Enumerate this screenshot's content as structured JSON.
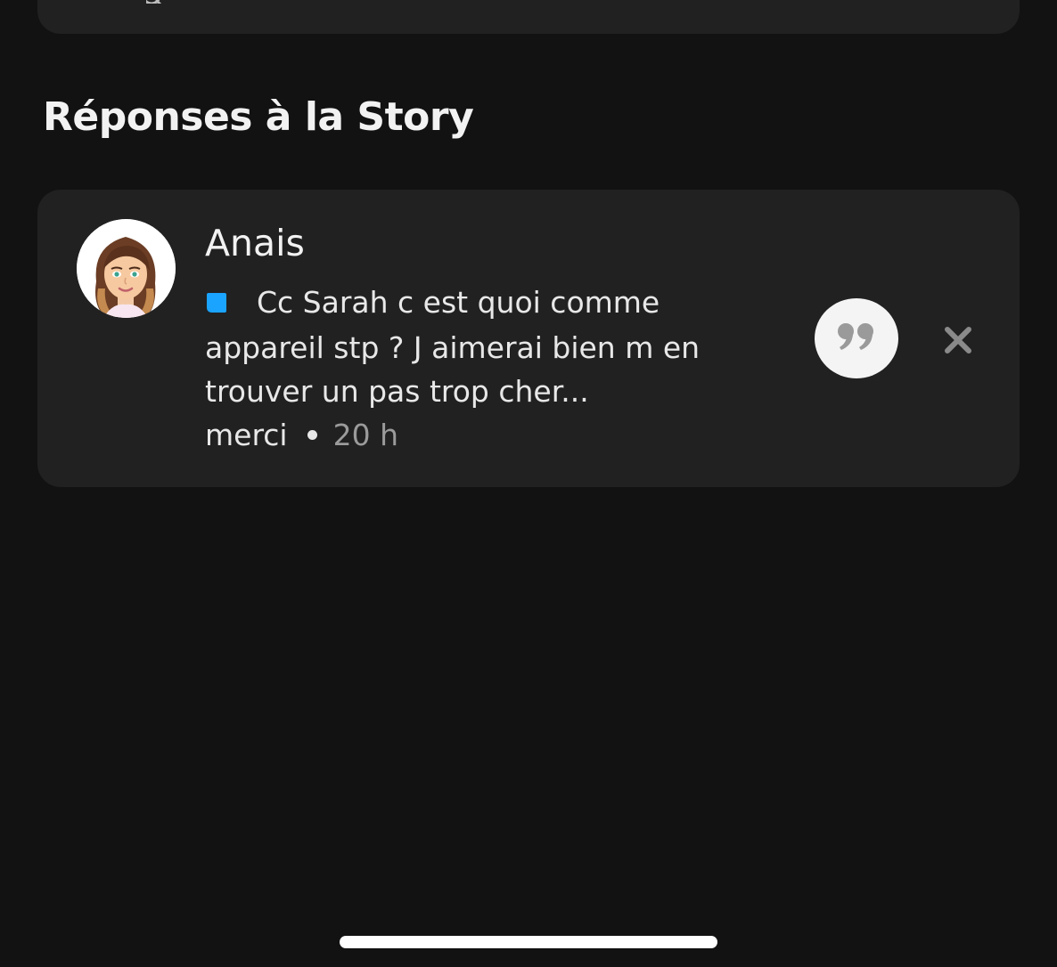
{
  "section": {
    "title": "Réponses à la Story"
  },
  "replies": [
    {
      "name": "Anais",
      "message": "Cc Sarah c est quoi comme appareil stp ? J aimerai bien m en trouver un pas trop cher... merci",
      "message_lines": [
        "Cc Sarah c est quoi comme",
        "appareil stp ? J aimerai bien m en",
        "trouver un pas trop cher...",
        "merci"
      ],
      "timestamp": "20 h",
      "avatar_icon": "bitmoji-avatar",
      "message_type_icon": "chat-bubble-icon",
      "actions": [
        "quote-reply-icon",
        "close-icon"
      ]
    }
  ],
  "colors": {
    "background": "#121212",
    "card": "#212121",
    "chat_icon": "#1aa3ff",
    "timestamp": "#9b9b9b",
    "quote_button_bg": "#f4f4f4",
    "quote_icon": "#9a9a9a",
    "close_icon": "#8a8a8a"
  }
}
